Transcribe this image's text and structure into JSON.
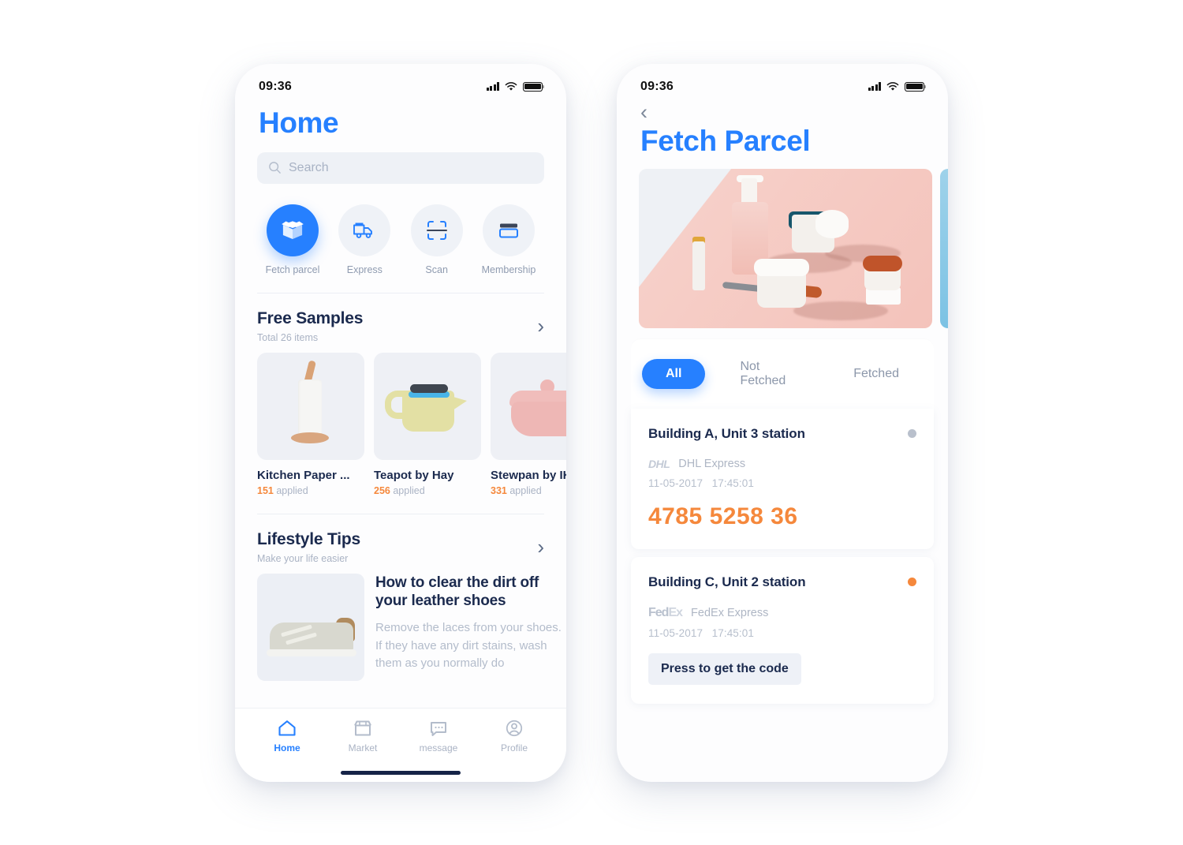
{
  "status_bar": {
    "time": "09:36"
  },
  "home": {
    "title": "Home",
    "search": {
      "placeholder": "Search"
    },
    "quick_actions": [
      {
        "label": "Fetch parcel",
        "icon": "box-icon",
        "active": true
      },
      {
        "label": "Express",
        "icon": "truck-icon",
        "active": false
      },
      {
        "label": "Scan",
        "icon": "scan-icon",
        "active": false
      },
      {
        "label": "Membership",
        "icon": "card-icon",
        "active": false
      }
    ],
    "free_samples": {
      "title": "Free Samples",
      "subtitle": "Total 26 items",
      "items": [
        {
          "name": "Kitchen Paper ...",
          "count": "151",
          "applied_label": "applied"
        },
        {
          "name": "Teapot by Hay",
          "count": "256",
          "applied_label": "applied"
        },
        {
          "name": "Stewpan by IK",
          "count": "331",
          "applied_label": "applied"
        }
      ]
    },
    "lifestyle_tips": {
      "title": "Lifestyle Tips",
      "subtitle": "Make your life easier",
      "article": {
        "headline": "How to clear the dirt off your leather shoes",
        "body": "Remove the laces from your shoes. If they have any dirt stains, wash them as you normally do"
      }
    },
    "tabbar": [
      {
        "label": "Home",
        "icon": "home-icon",
        "active": true
      },
      {
        "label": "Market",
        "icon": "store-icon",
        "active": false
      },
      {
        "label": "message",
        "icon": "chat-icon",
        "active": false
      },
      {
        "label": "Profile",
        "icon": "profile-icon",
        "active": false
      }
    ]
  },
  "fetch_parcel": {
    "title": "Fetch Parcel",
    "back_icon": "chevron-left-icon",
    "filters": [
      {
        "label": "All",
        "active": true
      },
      {
        "label": "Not Fetched",
        "active": false
      },
      {
        "label": "Fetched",
        "active": false
      }
    ],
    "parcels": [
      {
        "station": "Building A, Unit 3 station",
        "carrier_logo": "DHL",
        "carrier": "DHL Express",
        "date": "11-05-2017",
        "time": "17:45:01",
        "code": "4785  5258  36",
        "status_dot": "grey"
      },
      {
        "station": "Building C, Unit 2 station",
        "carrier_logo_a": "Fed",
        "carrier_logo_b": "Ex",
        "carrier": "FedEx Express",
        "date": "11-05-2017",
        "time": "17:45:01",
        "button": "Press to get the code",
        "status_dot": "orange"
      }
    ]
  },
  "colors": {
    "accent_blue": "#2680FF",
    "orange": "#F5883C",
    "navy": "#1B2A4E",
    "muted": "#AAB3C4"
  }
}
